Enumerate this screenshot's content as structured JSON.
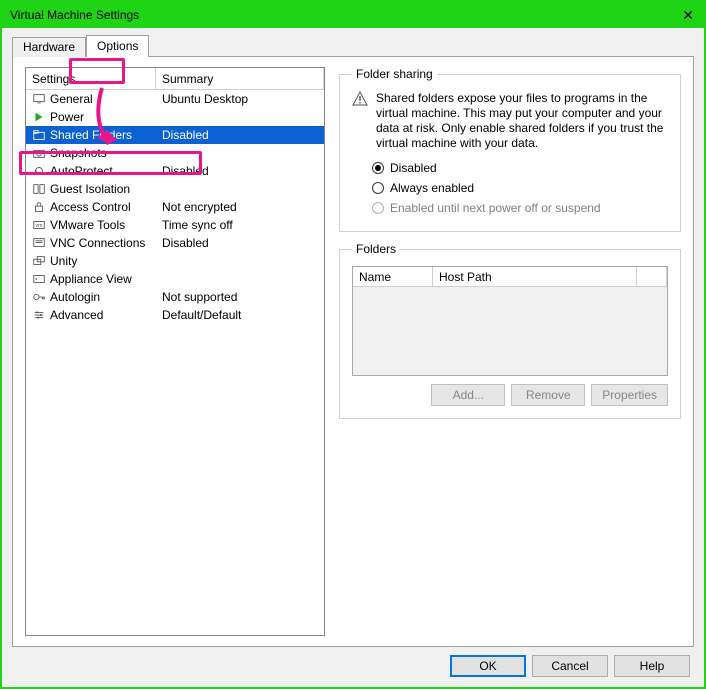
{
  "window": {
    "title": "Virtual Machine Settings",
    "close": "✕"
  },
  "tabs": {
    "hardware": "Hardware",
    "options": "Options"
  },
  "columns": {
    "settings": "Settings",
    "summary": "Summary"
  },
  "items": [
    {
      "name": "General",
      "summary": "Ubuntu Desktop"
    },
    {
      "name": "Power",
      "summary": ""
    },
    {
      "name": "Shared Folders",
      "summary": "Disabled"
    },
    {
      "name": "Snapshots",
      "summary": ""
    },
    {
      "name": "AutoProtect",
      "summary": "Disabled"
    },
    {
      "name": "Guest Isolation",
      "summary": ""
    },
    {
      "name": "Access Control",
      "summary": "Not encrypted"
    },
    {
      "name": "VMware Tools",
      "summary": "Time sync off"
    },
    {
      "name": "VNC Connections",
      "summary": "Disabled"
    },
    {
      "name": "Unity",
      "summary": ""
    },
    {
      "name": "Appliance View",
      "summary": ""
    },
    {
      "name": "Autologin",
      "summary": "Not supported"
    },
    {
      "name": "Advanced",
      "summary": "Default/Default"
    }
  ],
  "sharing": {
    "legend": "Folder sharing",
    "warning": "Shared folders expose your files to programs in the virtual machine. This may put your computer and your data at risk. Only enable shared folders if you trust the virtual machine with your data.",
    "opt_disabled": "Disabled",
    "opt_always": "Always enabled",
    "opt_until": "Enabled until next power off or suspend"
  },
  "folders": {
    "legend": "Folders",
    "col_name": "Name",
    "col_host": "Host Path",
    "btn_add": "Add...",
    "btn_remove": "Remove",
    "btn_props": "Properties"
  },
  "footer": {
    "ok": "OK",
    "cancel": "Cancel",
    "help": "Help"
  }
}
